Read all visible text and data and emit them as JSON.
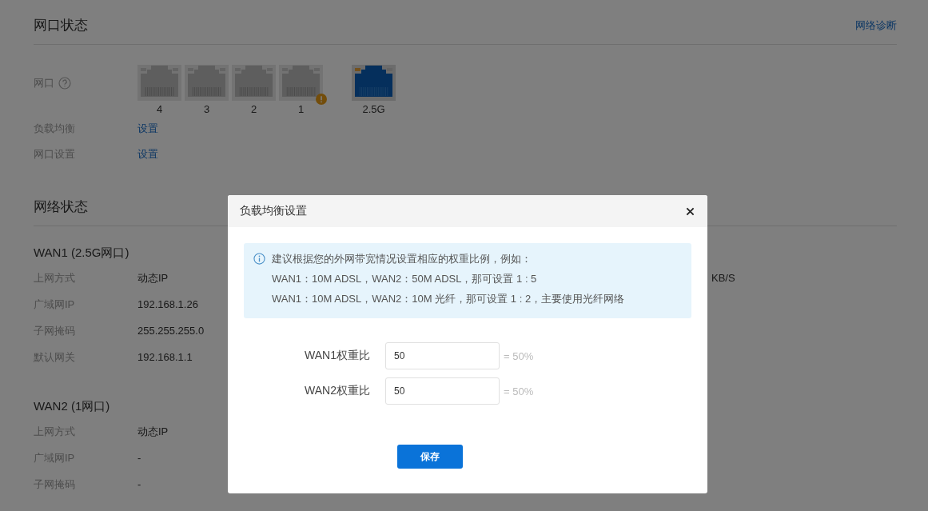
{
  "port_status": {
    "title": "网口状态",
    "diagnose_link": "网络诊断",
    "ports_label": "网口",
    "ports": [
      {
        "label": "4",
        "kind": "lan",
        "connected": false,
        "warning": false
      },
      {
        "label": "3",
        "kind": "lan",
        "connected": false,
        "warning": false
      },
      {
        "label": "2",
        "kind": "lan",
        "connected": false,
        "warning": false
      },
      {
        "label": "1",
        "kind": "lan",
        "connected": false,
        "warning": true
      },
      {
        "label": "2.5G",
        "kind": "wan",
        "connected": true,
        "warning": false
      }
    ],
    "settings": [
      {
        "label": "负载均衡",
        "link": "设置"
      },
      {
        "label": "网口设置",
        "link": "设置"
      }
    ]
  },
  "network_status": {
    "title": "网络状态",
    "wans": [
      {
        "title": "WAN1 (2.5G网口)",
        "rows": [
          {
            "label": "上网方式",
            "value": "动态IP"
          },
          {
            "label": "广域网IP",
            "value": "192.168.1.26"
          },
          {
            "label": "子网掩码",
            "value": "255.255.255.0"
          },
          {
            "label": "默认网关",
            "value": "192.168.1.1"
          }
        ]
      },
      {
        "title": "WAN2 (1网口)",
        "rows": [
          {
            "label": "上网方式",
            "value": "动态IP"
          },
          {
            "label": "广域网IP",
            "value": "-"
          },
          {
            "label": "子网掩码",
            "value": "-"
          }
        ]
      }
    ],
    "column_2": [
      {
        "kind": "rate",
        "value": "KB/S"
      }
    ]
  },
  "dialog": {
    "title": "负载均衡设置",
    "info_lines": [
      "建议根据您的外网带宽情况设置相应的权重比例，例如：",
      "WAN1：10M ADSL，WAN2：50M ADSL，那可设置 1 : 5",
      "WAN1：10M ADSL，WAN2：10M 光纤，那可设置 1 : 2，主要使用光纤网络"
    ],
    "fields": [
      {
        "label": "WAN1权重比",
        "value": "50",
        "percent": "= 50%"
      },
      {
        "label": "WAN2权重比",
        "value": "50",
        "percent": "= 50%"
      }
    ],
    "save_button": "保存"
  }
}
